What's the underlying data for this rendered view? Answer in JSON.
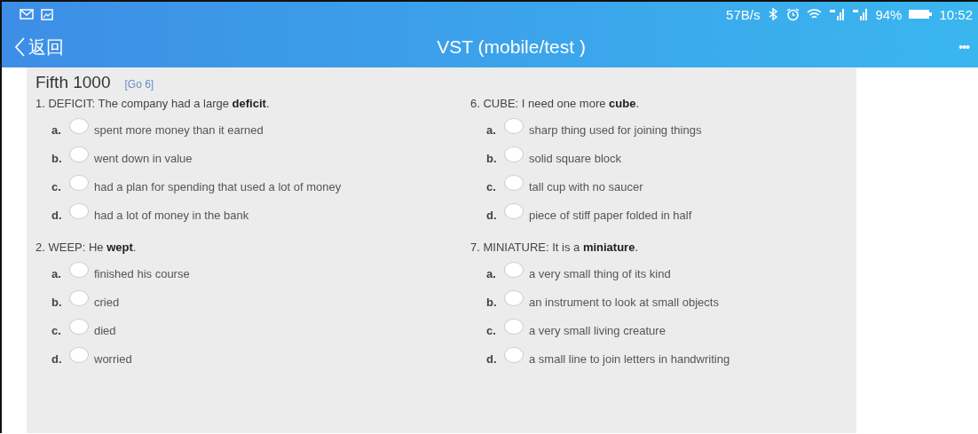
{
  "status_bar": {
    "speed": "57B/s",
    "battery": "94%",
    "time": "10:52"
  },
  "header": {
    "back_label": "返回",
    "title": "VST (mobile/test )",
    "more": "•••"
  },
  "quiz": {
    "title": "Fifth 1000",
    "link": "[Go 6]",
    "columns": [
      {
        "questions": [
          {
            "text": "1. DEFICIT: The company had a large **deficit**.",
            "options": [
              {
                "letter": "a.",
                "text": "spent more money than it earned",
                "selected": false
              },
              {
                "letter": "b.",
                "text": "went down in value",
                "selected": false
              },
              {
                "letter": "c.",
                "text": "had a plan for spending that used a lot of money",
                "selected": false
              },
              {
                "letter": "d.",
                "text": "had a lot of money in the bank",
                "selected": false
              }
            ]
          },
          {
            "text": "2. WEEP: He **wept**.",
            "options": [
              {
                "letter": "a.",
                "text": "finished his course",
                "selected": false
              },
              {
                "letter": "b.",
                "text": "cried",
                "selected": false
              },
              {
                "letter": "c.",
                "text": "died",
                "selected": false
              },
              {
                "letter": "d.",
                "text": "worried",
                "selected": false
              }
            ]
          }
        ]
      },
      {
        "questions": [
          {
            "text": "6. CUBE: I need one more **cube**.",
            "options": [
              {
                "letter": "a.",
                "text": "sharp thing used for joining things",
                "selected": false
              },
              {
                "letter": "b.",
                "text": "solid square block",
                "selected": false
              },
              {
                "letter": "c.",
                "text": "tall cup with no saucer",
                "selected": false
              },
              {
                "letter": "d.",
                "text": "piece of stiff paper folded in half",
                "selected": false
              }
            ]
          },
          {
            "text": "7. MINIATURE: It is a **miniature**.",
            "options": [
              {
                "letter": "a.",
                "text": "a very small thing of its kind",
                "selected": false
              },
              {
                "letter": "b.",
                "text": "an instrument to look at small objects",
                "selected": false
              },
              {
                "letter": "c.",
                "text": "a very small living creature",
                "selected": false
              },
              {
                "letter": "d.",
                "text": "a small line to join letters in handwriting",
                "selected": false
              }
            ]
          }
        ]
      }
    ]
  }
}
